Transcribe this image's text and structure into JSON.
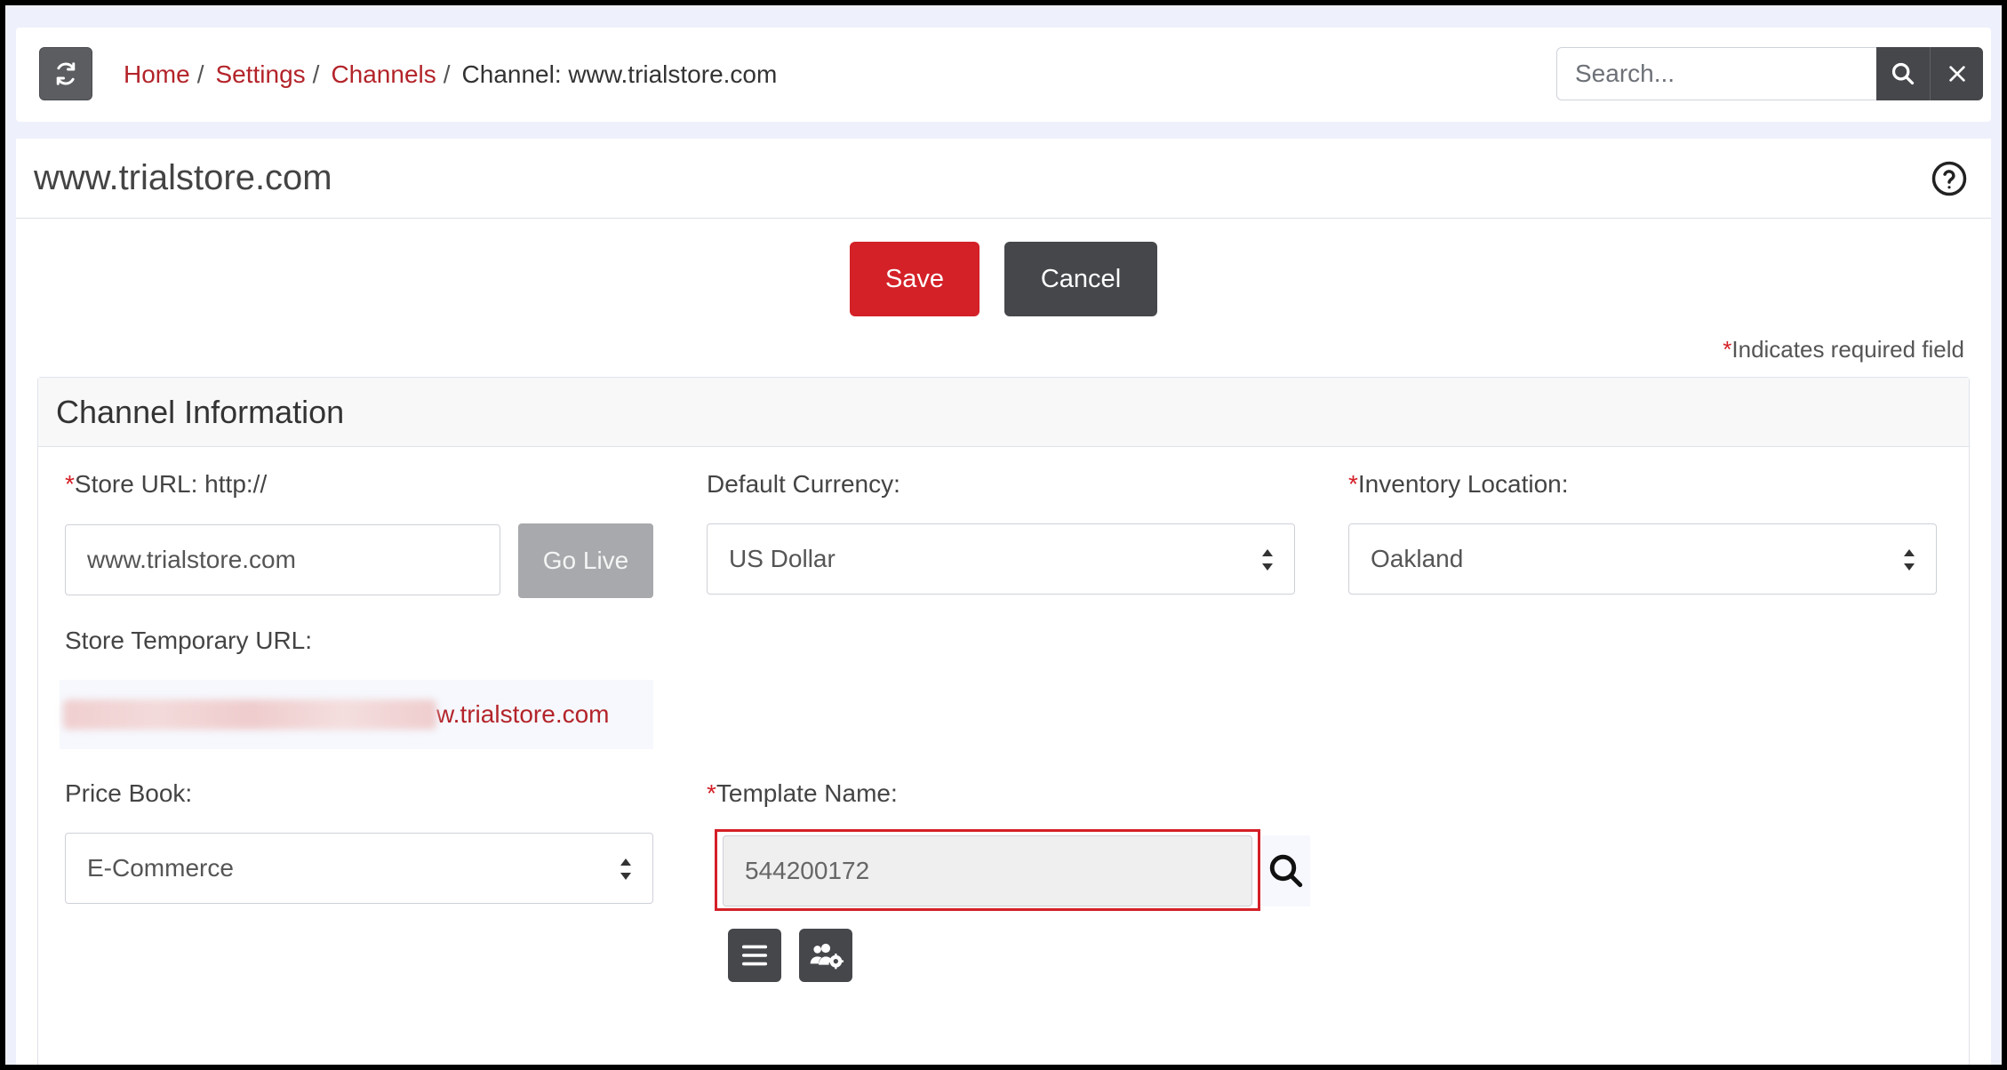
{
  "breadcrumb": {
    "home": "Home",
    "settings": "Settings",
    "channels": "Channels",
    "current": "Channel: www.trialstore.com",
    "separator": "/"
  },
  "search": {
    "placeholder": "Search..."
  },
  "page": {
    "title": "www.trialstore.com"
  },
  "actions": {
    "save_label": "Save",
    "cancel_label": "Cancel"
  },
  "required_note": {
    "star": "*",
    "text": "Indicates required field"
  },
  "section": {
    "title": "Channel Information",
    "store_url": {
      "star": "*",
      "label": "Store URL: http://",
      "value": "www.trialstore.com",
      "go_live_label": "Go Live"
    },
    "default_currency": {
      "label": "Default Currency:",
      "value": "US Dollar"
    },
    "inventory_location": {
      "star": "*",
      "label": "Inventory Location:",
      "value": "Oakland"
    },
    "store_temp_url": {
      "label": "Store Temporary URL:",
      "visible_link_text": "w.trialstore.com"
    },
    "price_book": {
      "label": "Price Book:",
      "value": "E-Commerce"
    },
    "template_name": {
      "star": "*",
      "label": "Template Name:",
      "value": "544200172"
    }
  },
  "colors": {
    "accent_red": "#d42027",
    "link_red": "#b3242a",
    "dark_button": "#45474b",
    "disabled_button": "#a7a9ac",
    "background": "#eef0fb"
  },
  "icons": {
    "refresh": "refresh-icon",
    "search": "search-icon",
    "close": "close-icon",
    "help": "help-icon",
    "select_arrows": "sort-arrows-icon",
    "lookup": "search-icon",
    "list": "list-icon",
    "users_settings": "user-gear-icon"
  }
}
